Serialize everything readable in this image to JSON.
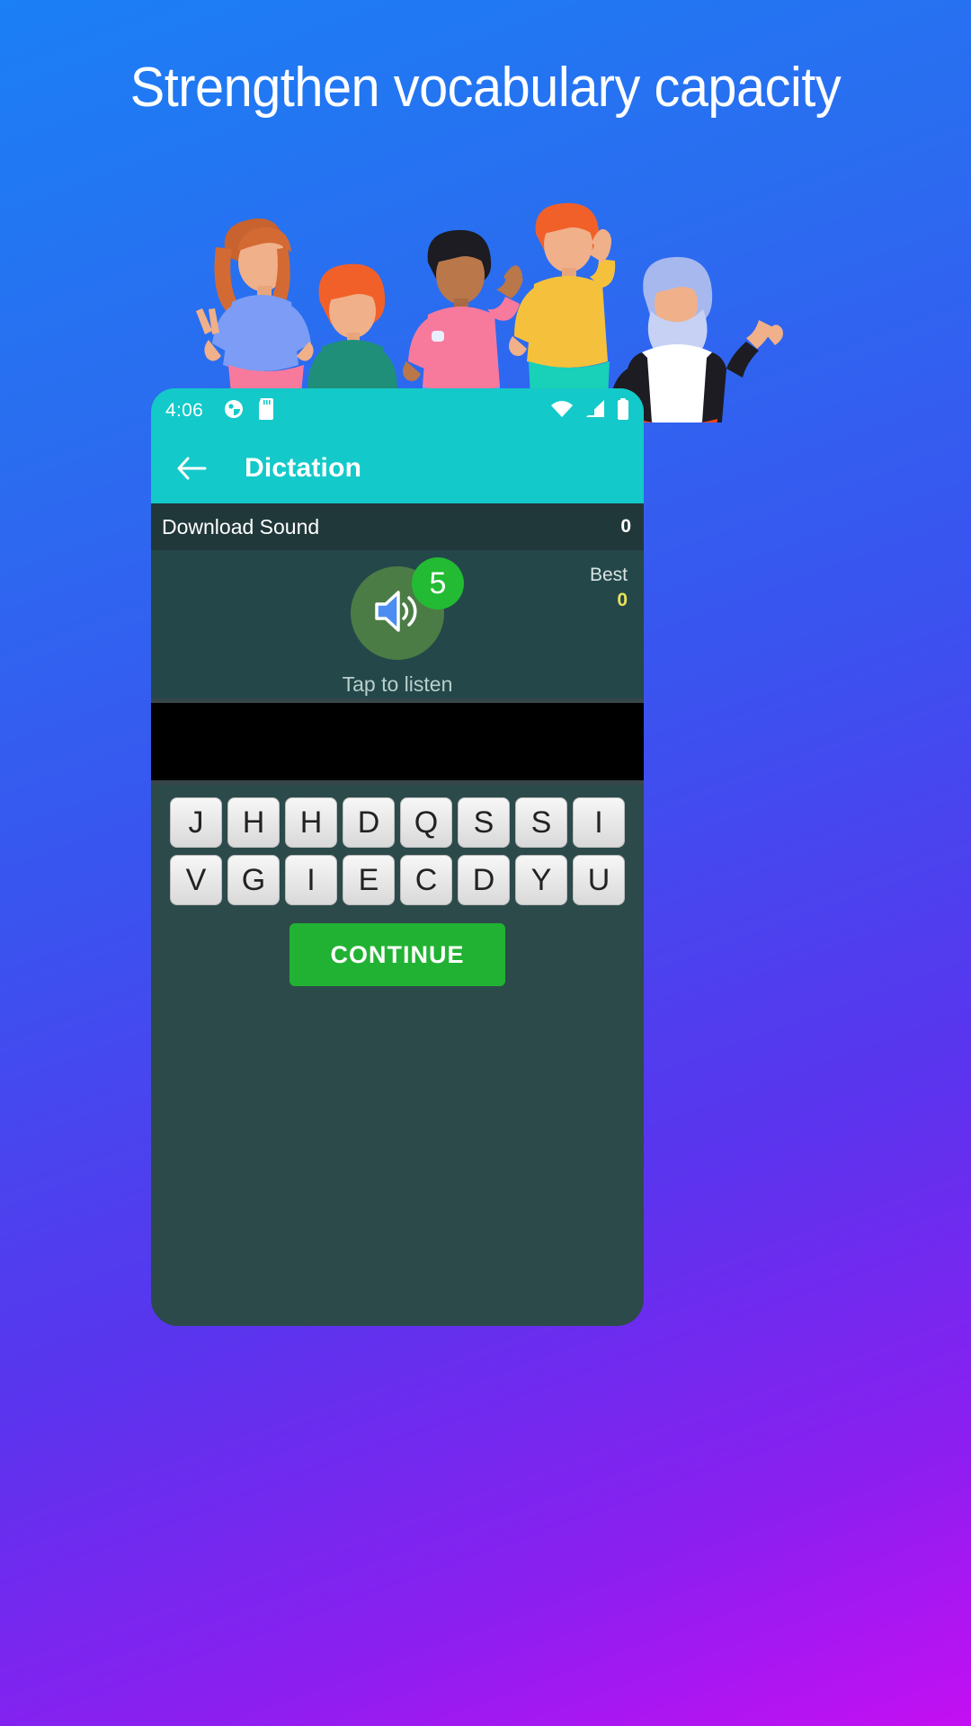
{
  "promo": {
    "headline": "Strengthen vocabulary capacity"
  },
  "phone": {
    "status_bar": {
      "time": "4:06",
      "left_icons": [
        "app-notification-icon",
        "sd-card-icon"
      ],
      "right_icons": [
        "wifi-icon",
        "signal-icon",
        "battery-icon"
      ]
    },
    "app_bar": {
      "back_icon": "back-arrow-icon",
      "title": "Dictation"
    },
    "download_bar": {
      "label": "Download Sound",
      "count": "0"
    },
    "sound_card": {
      "speaker_icon": "speaker-icon",
      "badge_count": "5",
      "tap_hint": "Tap to listen",
      "best_label": "Best",
      "best_value": "0"
    },
    "ad_banner": {
      "label": ""
    },
    "keyboard": {
      "row1": [
        "J",
        "H",
        "H",
        "D",
        "Q",
        "S",
        "S",
        "I"
      ],
      "row2": [
        "V",
        "G",
        "I",
        "E",
        "C",
        "D",
        "Y",
        "U"
      ]
    },
    "continue_button": {
      "label": "CONTINUE"
    }
  },
  "colors": {
    "teal_appbar": "#14c9c9",
    "dark_bar": "#21383a",
    "card_bg": "#24474a",
    "screen_bg": "#2c4a4a",
    "badge_green": "#22bb33",
    "continue_green": "#22b233",
    "best_value_yellow": "#e8e25a"
  }
}
